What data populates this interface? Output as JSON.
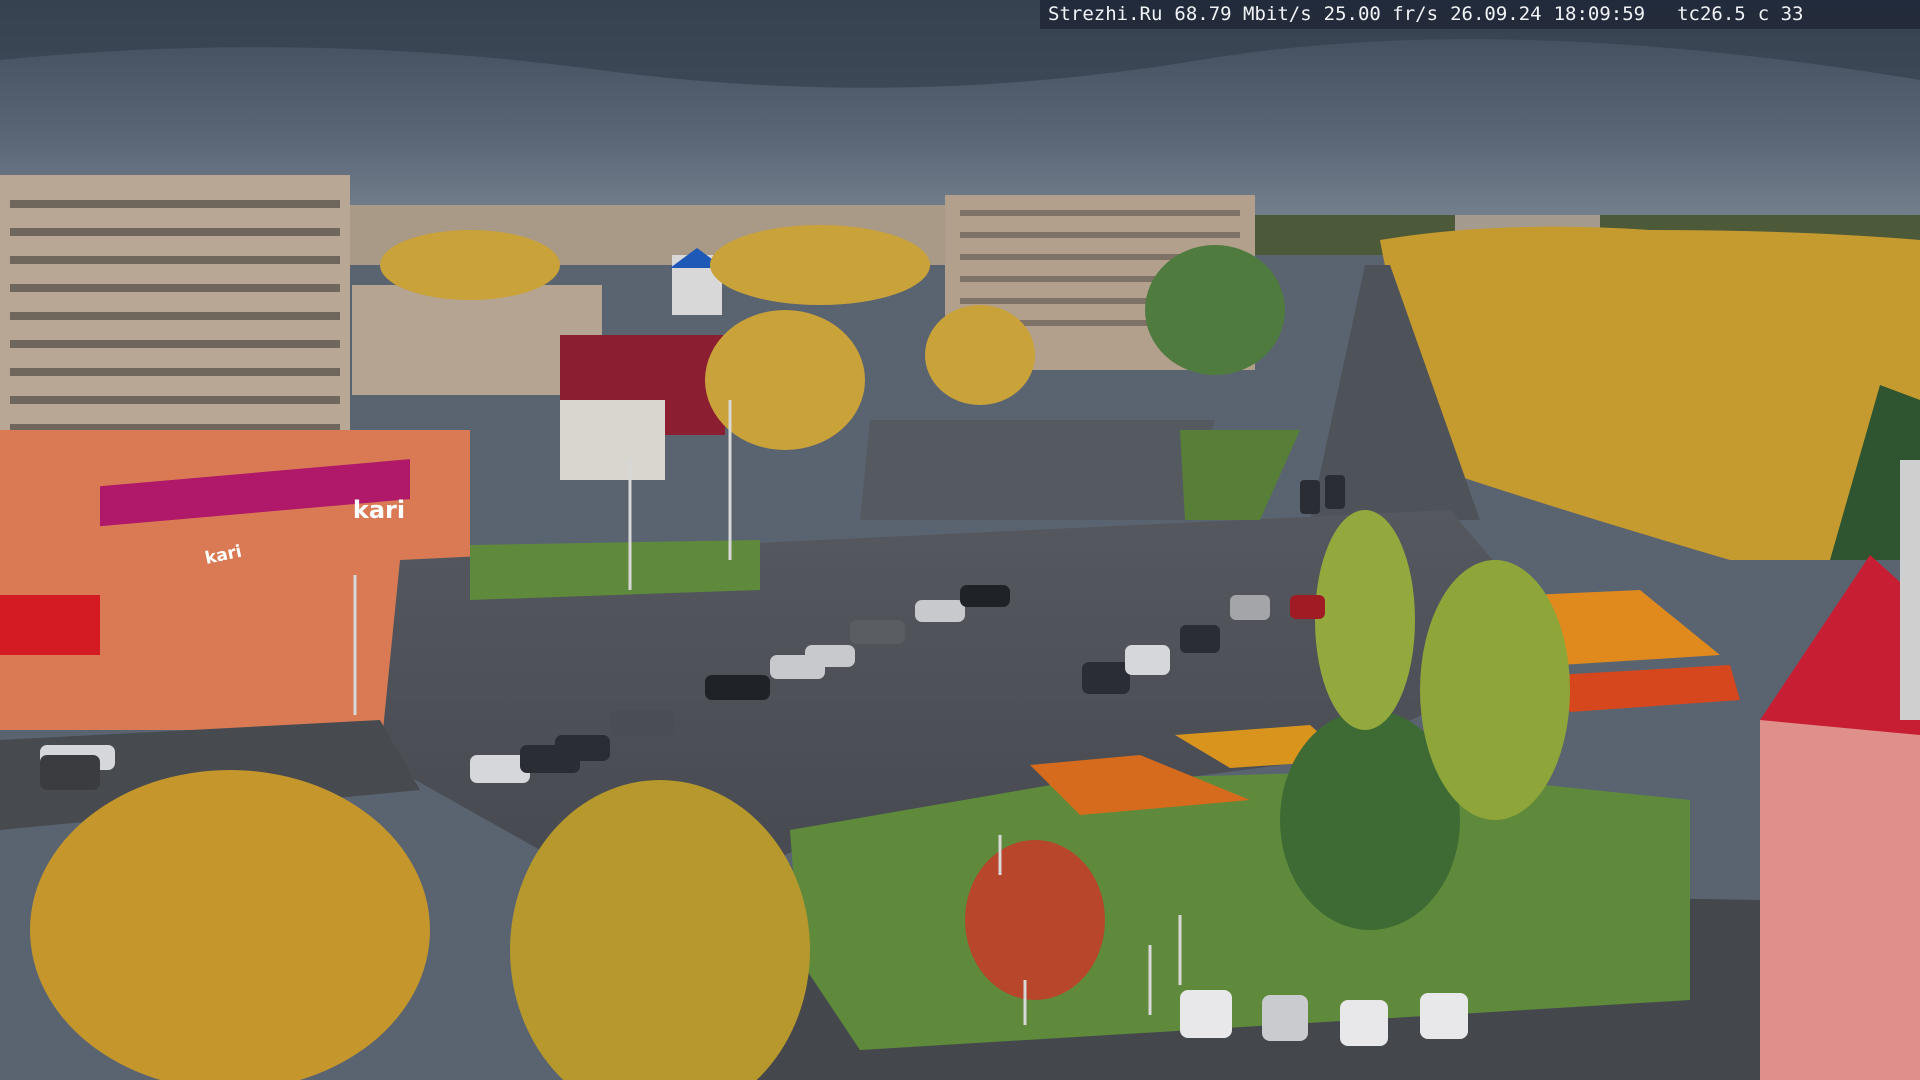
{
  "overlay": {
    "site": "Strezhi.Ru",
    "bitrate": "68.79 Mbit/s",
    "framerate": "25.00 fr/s",
    "date": "26.09.24",
    "time": "18:09:59",
    "temperature": "tc26.5",
    "cam": "c 33"
  },
  "storefront_sign": {
    "brand": "kari",
    "brand_small": "kari"
  },
  "colors": {
    "sky": "#4c5868",
    "road": "#4a5057",
    "grass": "#5f8a3c",
    "foliage": "#c99a2c",
    "storefront": "#b0186a",
    "facade": "#d97a55"
  }
}
